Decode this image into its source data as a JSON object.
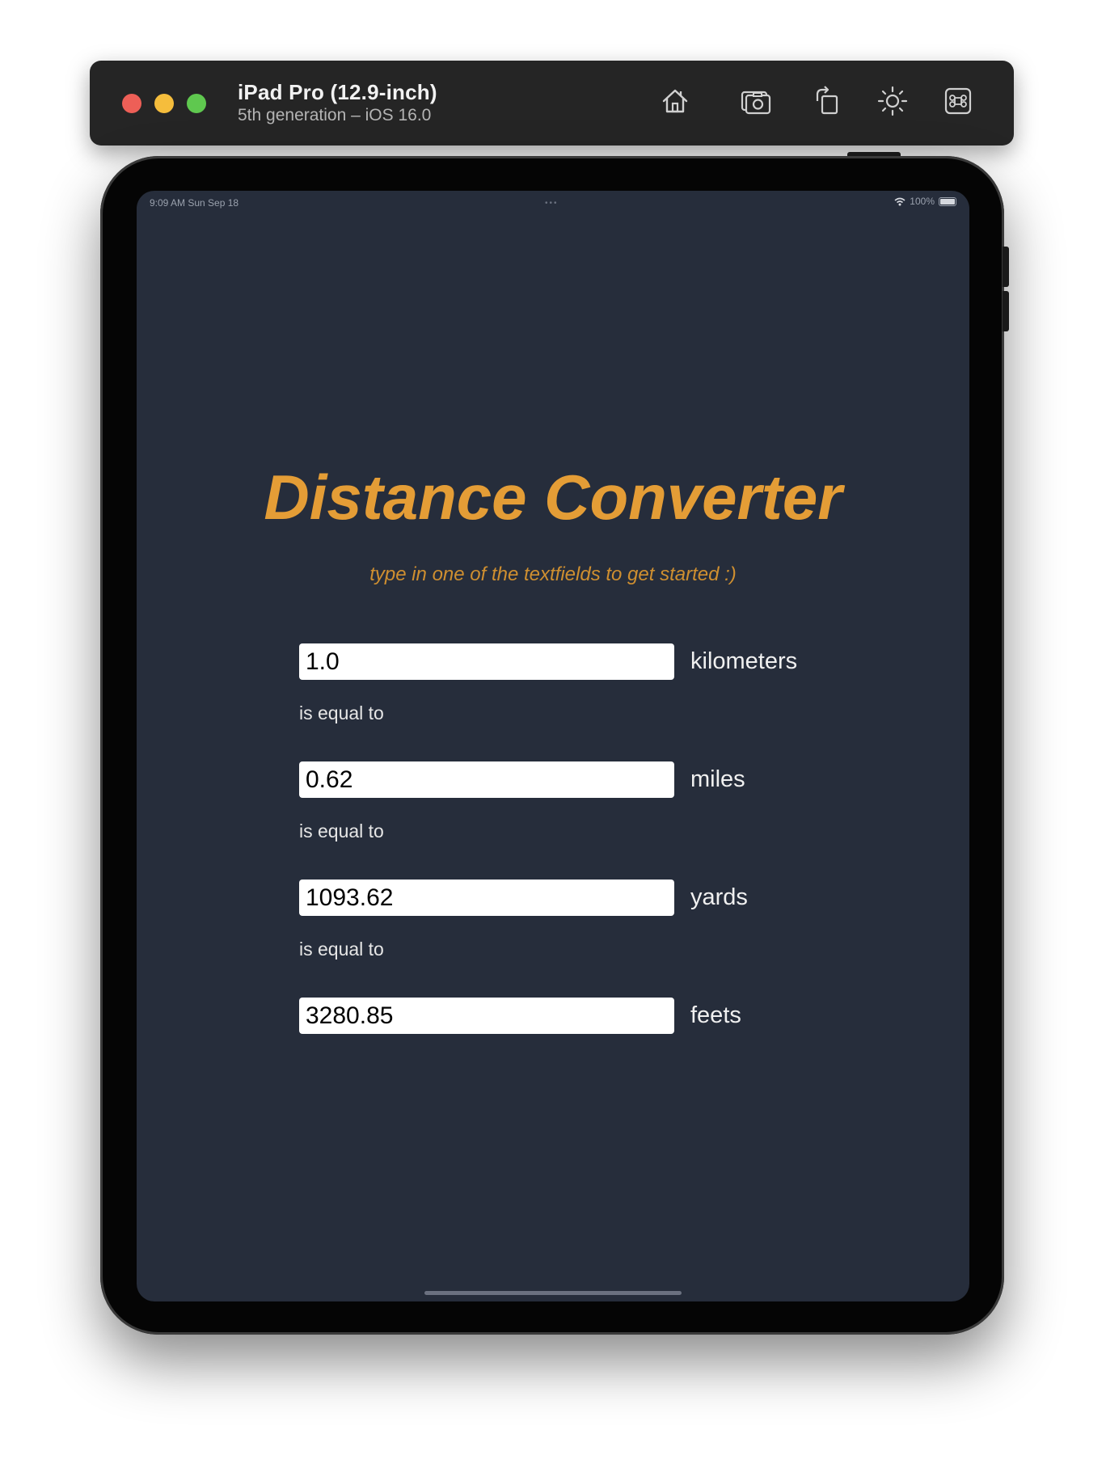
{
  "simulator": {
    "device_name": "iPad Pro (12.9-inch)",
    "device_details": "5th generation – iOS 16.0",
    "toolbar": [
      "home-icon",
      "screenshot-icon",
      "rotate-icon",
      "appearance-icon",
      "command-icon"
    ]
  },
  "status_bar": {
    "time_date": "9:09 AM   Sun Sep 18",
    "battery": "100%"
  },
  "app": {
    "title": "Distance Converter",
    "subtitle": "type in one of the textfields to get started :)",
    "title_color": "#e49d36",
    "background": "#262d3b",
    "rows": [
      {
        "value": "1.0",
        "unit": "kilometers"
      },
      {
        "value": "0.62",
        "unit": "miles"
      },
      {
        "value": "1093.62",
        "unit": "yards"
      },
      {
        "value": "3280.85",
        "unit": "feets"
      }
    ],
    "separator": "is equal to"
  }
}
